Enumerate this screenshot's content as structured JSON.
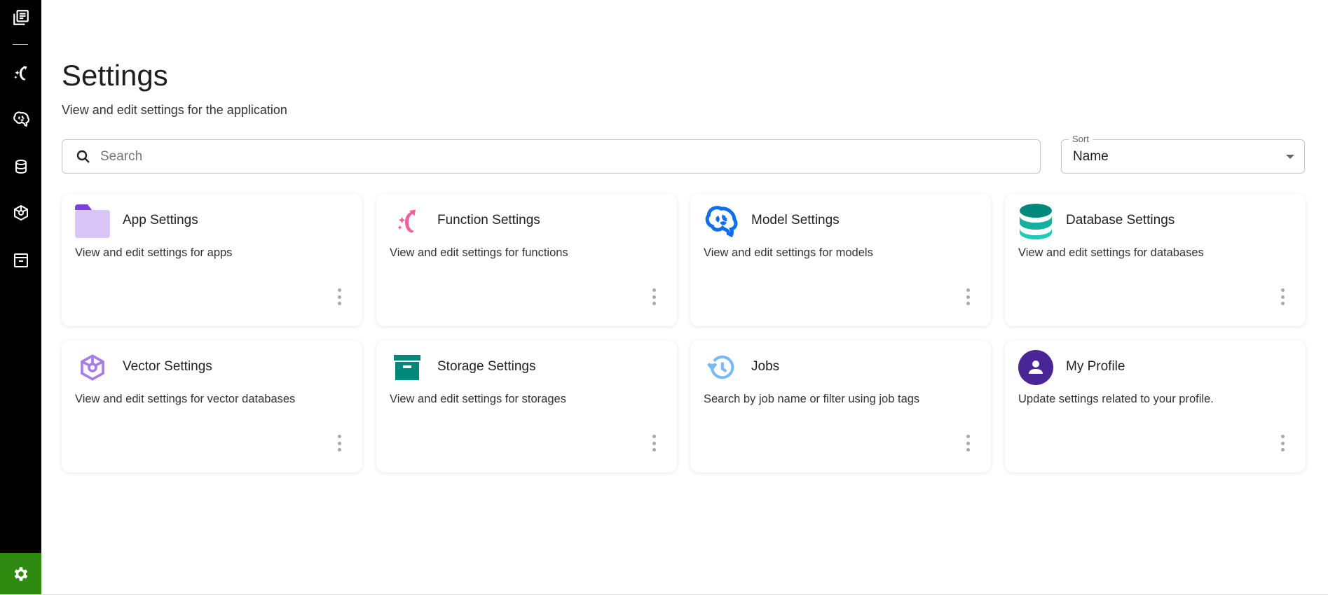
{
  "sidebar": {
    "items": [
      {
        "icon": "library-books-icon"
      },
      {
        "icon": "function-icon"
      },
      {
        "icon": "brain-icon"
      },
      {
        "icon": "database-icon"
      },
      {
        "icon": "vector-cube-icon"
      },
      {
        "icon": "archive-icon"
      }
    ],
    "active": {
      "icon": "gear-icon",
      "color": "#2f8a12"
    }
  },
  "header": {
    "title": "Settings",
    "subtitle": "View and edit settings for the application"
  },
  "search": {
    "placeholder": "Search",
    "value": ""
  },
  "sort": {
    "label": "Sort",
    "value": "Name"
  },
  "cards": [
    {
      "title": "App Settings",
      "description": "View and edit settings for apps",
      "icon": "folder-icon",
      "color": "#d8c4f5"
    },
    {
      "title": "Function Settings",
      "description": "View and edit settings for functions",
      "icon": "function-icon",
      "color": "#f0609e"
    },
    {
      "title": "Model Settings",
      "description": "View and edit settings for models",
      "icon": "brain-icon",
      "color": "#0f6ef0"
    },
    {
      "title": "Database Settings",
      "description": "View and edit settings for databases",
      "icon": "database-icon",
      "color": "#00897b"
    },
    {
      "title": "Vector Settings",
      "description": "View and edit settings for vector databases",
      "icon": "vector-cube-icon",
      "color": "#a77ce8"
    },
    {
      "title": "Storage Settings",
      "description": "View and edit settings for storages",
      "icon": "archive-icon",
      "color": "#00897b"
    },
    {
      "title": "Jobs",
      "description": "Search by job name or filter using job tags",
      "icon": "history-icon",
      "color": "#7ab8f5"
    },
    {
      "title": "My Profile",
      "description": "Update settings related to your profile.",
      "icon": "person-icon",
      "color": "#4a2595"
    }
  ]
}
